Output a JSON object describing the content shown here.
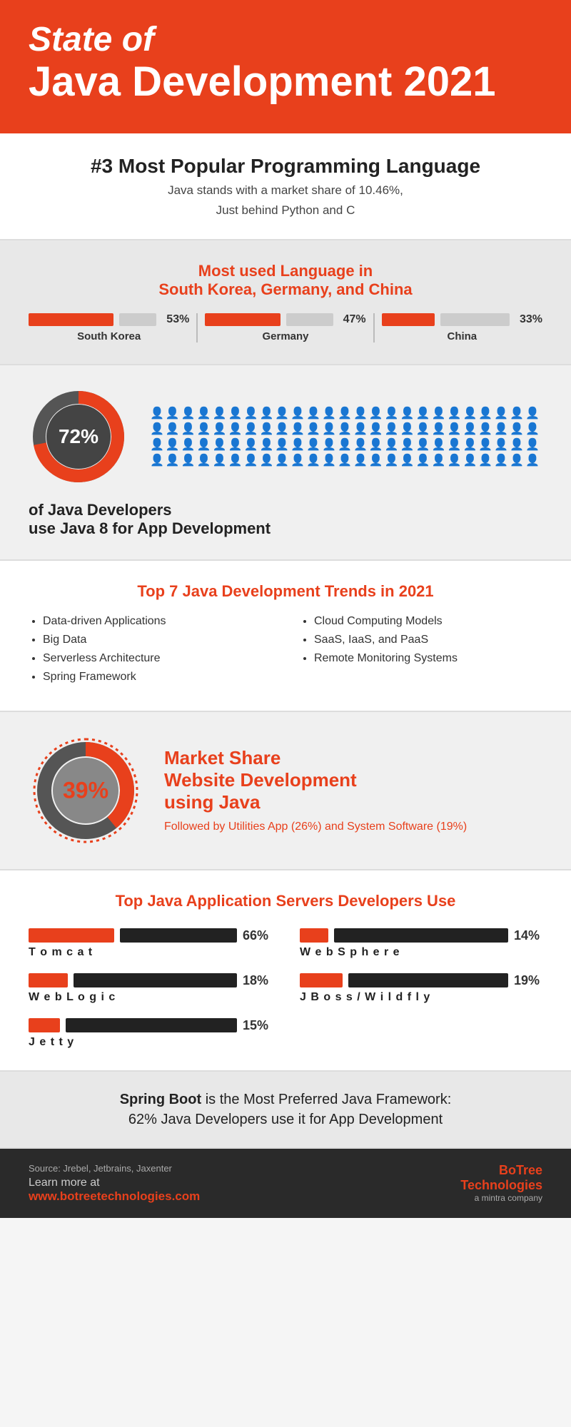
{
  "header": {
    "line1": "State of",
    "line2": "Java Development 2021"
  },
  "popular": {
    "title": "#3 Most Popular Programming Language",
    "desc1": "Java stands with a market share of 10.46%,",
    "desc2": "Just behind Python and C"
  },
  "language": {
    "heading_line1": "Most used Language in",
    "heading_line2": "South Korea, Germany, and China",
    "countries": [
      {
        "name": "South Korea",
        "pct": 53,
        "label": "53%"
      },
      {
        "name": "Germany",
        "pct": 47,
        "label": "47%"
      },
      {
        "name": "China",
        "pct": 33,
        "label": "33%"
      }
    ]
  },
  "java8": {
    "pct": 72,
    "label": "72%",
    "text_line1": "of Java Developers",
    "text_line2": "use Java 8 for App Development",
    "orange_count": 72,
    "gray_count": 28
  },
  "trends": {
    "heading": "Top 7 Java Development Trends in 2021",
    "left": [
      "Data-driven Applications",
      "Big Data",
      "Serverless Architecture",
      "Spring Framework"
    ],
    "right": [
      "Cloud Computing Models",
      "SaaS, IaaS, and PaaS",
      "Remote Monitoring Systems"
    ]
  },
  "market": {
    "pct": 39,
    "label": "39%",
    "title_line1": "Market Share",
    "title_line2": "Website Development",
    "title_line3_prefix": "using ",
    "title_line3_java": "Java",
    "followed": "Followed by Utilities App (26%) and System Software (19%)"
  },
  "servers": {
    "heading": "Top Java Application Servers Developers Use",
    "items": [
      {
        "name": "Tomcat",
        "pct": 66,
        "label": "66%"
      },
      {
        "name": "WebSphere",
        "pct": 14,
        "label": "14%"
      },
      {
        "name": "WebLogic",
        "pct": 18,
        "label": "18%"
      },
      {
        "name": "JBoss/Wildfly",
        "pct": 19,
        "label": "19%"
      },
      {
        "name": "Jetty",
        "pct": 15,
        "label": "15%"
      }
    ]
  },
  "spring": {
    "text1": "Spring Boot",
    "text2": " is the Most Preferred Java Framework:",
    "text3": "62% Java Developers use it for App Development"
  },
  "footer": {
    "source": "Source: Jrebel, Jetbrains, Jaxenter",
    "learn": "Learn more at",
    "url": "www.botreetechnologies.com",
    "logo_bo": "Bo",
    "logo_tree": "Tree",
    "logo_tech": "Technologies",
    "logo_sub": "a mintra company"
  }
}
